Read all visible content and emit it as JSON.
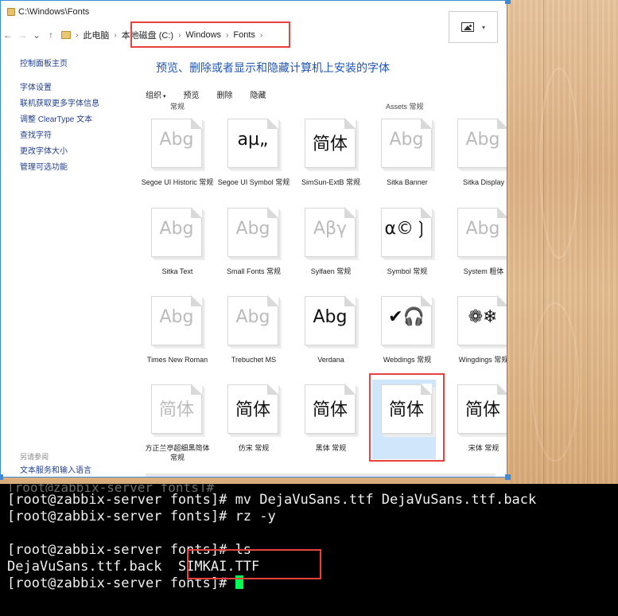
{
  "window": {
    "title": "C:\\Windows\\Fonts",
    "breadcrumb": [
      "此电脑",
      "本地磁盘 (C:)",
      "Windows",
      "Fonts"
    ]
  },
  "nav": {
    "back": "←",
    "forward": "→",
    "dropdown": "⌄",
    "up": "↑",
    "sep": "›"
  },
  "sidebar": {
    "home": "控制面板主页",
    "links": [
      "字体设置",
      "联机获取更多字体信息",
      "调整 ClearType 文本",
      "查找字符",
      "更改字体大小",
      "管理可选功能"
    ],
    "see_also": "另请参阅",
    "bottom_link": "文本服务和输入语言"
  },
  "heading": "预览、删除或者显示和隐藏计算机上安装的字体",
  "toolbar": [
    "组织",
    "预览",
    "删除",
    "隐藏"
  ],
  "top_partial_labels": [
    "常规",
    "Assets 常规"
  ],
  "fonts": [
    {
      "sample": "Abg",
      "name": "Segoe UI Historic 常规",
      "dark": false
    },
    {
      "sample": "aµ„",
      "name": "Segoe UI Symbol 常规",
      "dark": true
    },
    {
      "sample": "简体",
      "name": "SimSun-ExtB 常规",
      "dark": true
    },
    {
      "sample": "Abg",
      "name": "Sitka Banner",
      "dark": false
    },
    {
      "sample": "Abg",
      "name": "Sitka Display",
      "dark": false
    },
    {
      "sample": "Abg",
      "name": "Sitka Text",
      "dark": false
    },
    {
      "sample": "Abg",
      "name": "Small Fonts 常规",
      "dark": false
    },
    {
      "sample": "Αβγ",
      "name": "Sylfaen 常规",
      "dark": false
    },
    {
      "sample": "α©❳",
      "name": "Symbol 常规",
      "dark": true
    },
    {
      "sample": "Abg",
      "name": "System 粗体",
      "dark": false
    },
    {
      "sample": "Abg",
      "name": "Times New Roman",
      "dark": false
    },
    {
      "sample": "Abg",
      "name": "Trebuchet MS",
      "dark": false
    },
    {
      "sample": "Abg",
      "name": "Verdana",
      "dark": true
    },
    {
      "sample": "✔🎧",
      "name": "Webdings 常规",
      "dark": true
    },
    {
      "sample": "❁❄",
      "name": "Wingdings 常规",
      "dark": true
    },
    {
      "sample": "简体",
      "name": "方正兰亭超细黑简体 常规",
      "dark": false
    },
    {
      "sample": "简体",
      "name": "仿宋 常规",
      "dark": true
    },
    {
      "sample": "简体",
      "name": "黑体 常规",
      "dark": true
    },
    {
      "sample": "简体",
      "name": "楷体 常规",
      "dark": true
    },
    {
      "sample": "简体",
      "name": "宋体 常规",
      "dark": true
    }
  ],
  "terminal": {
    "lines": [
      "[root@zabbix-server fonts]# mv DejaVuSans.ttf DejaVuSans.ttf.back",
      "[root@zabbix-server fonts]# rz -y",
      "",
      "[root@zabbix-server fonts]# ls",
      "DejaVuSans.ttf.back  SIMKAI.TTF",
      "[root@zabbix-server fonts]# "
    ],
    "faded_top": "[root@zabbix-server fonts]#"
  },
  "colors": {
    "highlight": "#e8413e",
    "link": "#1f3f8f",
    "heading": "#1f55b5",
    "cursor": "#00ff55"
  }
}
